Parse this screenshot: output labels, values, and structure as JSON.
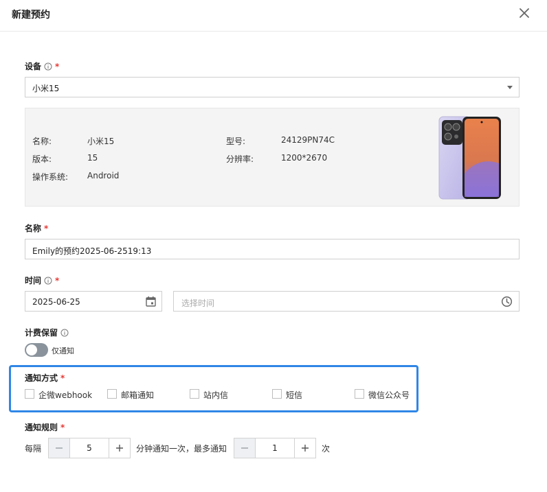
{
  "dialog": {
    "title": "新建预约"
  },
  "device": {
    "label": "设备",
    "required_mark": "*",
    "selected": "小米15",
    "info": {
      "name_key": "名称:",
      "name_val": "小米15",
      "version_key": "版本:",
      "version_val": "15",
      "os_key": "操作系统:",
      "os_val": "Android",
      "model_key": "型号:",
      "model_val": "24129PN74C",
      "resolution_key": "分辨率:",
      "resolution_val": "1200*2670"
    }
  },
  "name_field": {
    "label": "名称",
    "required_mark": "*",
    "value": "Emily的预约2025-06-2519:13"
  },
  "time_field": {
    "label": "时间",
    "required_mark": "*",
    "date": "2025-06-25",
    "time_placeholder": "选择时间"
  },
  "billing": {
    "label": "计费保留",
    "toggle_label": "仅通知",
    "enabled": false
  },
  "notify_method": {
    "label": "通知方式",
    "required_mark": "*",
    "options": [
      "企微webhook",
      "邮箱通知",
      "站内信",
      "短信",
      "微信公众号"
    ]
  },
  "notify_rule": {
    "label": "通知规则",
    "required_mark": "*",
    "prefix": "每隔",
    "interval": "5",
    "middle": "分钟通知一次，最多通知",
    "max": "1",
    "suffix": "次"
  },
  "icons": [
    "close-icon",
    "info-icon",
    "caret-down-icon",
    "calendar-icon",
    "clock-icon",
    "plus-icon",
    "minus-icon"
  ],
  "colors": {
    "accent_border": "#2f86e6",
    "required": "#e53935",
    "toggle_off": "#8a939c"
  }
}
